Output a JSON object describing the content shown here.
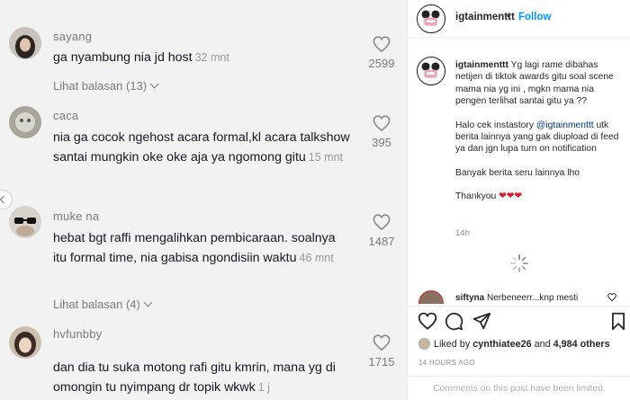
{
  "tiktok": {
    "comments": [
      {
        "username": "sayang",
        "text": "ga nyambung nia jd host",
        "time": "32 mnt",
        "likes": "2599",
        "replies": "Lihat balasan (13)"
      },
      {
        "username": "caca",
        "text": "nia ga cocok ngehost acara formal,kl acara talkshow santai mungkin oke oke aja ya ngomong gitu",
        "time": "15 mnt",
        "likes": "395",
        "replies": ""
      },
      {
        "username": "muke na",
        "text": "hebat bgt raffi mengalihkan pembicaraan. soalnya itu formal time, nia gabisa ngondisiin waktu",
        "time": "46 mnt",
        "likes": "1487",
        "replies": "Lihat balasan (4)"
      },
      {
        "username": "hvfunbby",
        "text": "dan dia tu suka motong rafi gitu kmrin, mana yg di omongin tu nyimpang dr topik wkwk",
        "time": "1 j",
        "likes": "1715",
        "replies": ""
      }
    ]
  },
  "instagram": {
    "header": {
      "username": "igtainmenttt",
      "separator": "•",
      "follow_label": "Follow"
    },
    "caption": {
      "username": "igtainmenttt",
      "text": "Yg lagi rame dibahas netijen di tiktok awards gitu soal scene mama nia yg ini , mgkn mama nia pengen terlihat santai gitu ya ??",
      "para2_prefix": "Halo cek instastory",
      "para2_mention": "@igtainmenttt",
      "para2_suffix": "utk berita lainnya yang gak diupload di feed ya dan jgn lupa turn on notification",
      "para3": "Banyak berita seru lainnya lho",
      "para4": "Thankyou",
      "hearts": "❤❤❤",
      "age": "14h"
    },
    "next_comment": {
      "username": "siftyna",
      "text": "Nerbeneerr...knp mesti"
    },
    "likes": {
      "prefix": "Liked by",
      "user": "cynthiatee26",
      "middle": "and",
      "others": "4,984 others"
    },
    "timestamp": "14 HOURS AGO",
    "comments_limited": "Comments on this post have been limited."
  },
  "icons": {
    "heart": "heart-icon",
    "comment": "comment-icon",
    "share": "share-icon",
    "bookmark": "bookmark-icon",
    "spinner": "loading-spinner-icon",
    "carousel_prev": "chevron-left-icon"
  },
  "colors": {
    "follow_blue": "#0095f6",
    "hearts_red": "#d1202f",
    "comment_bg": "#f2f2f2"
  }
}
